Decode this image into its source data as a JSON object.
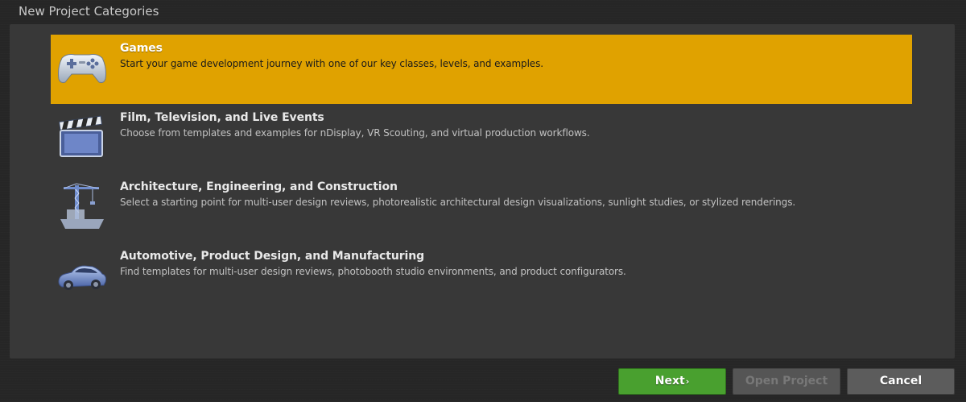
{
  "dialog": {
    "title": "New Project Categories"
  },
  "categories": [
    {
      "title": "Games",
      "description": "Start your game development journey with one of our key classes, levels, and examples.",
      "icon": "gamepad-icon",
      "selected": true
    },
    {
      "title": "Film, Television, and Live Events",
      "description": "Choose from templates and examples for nDisplay, VR Scouting, and virtual production workflows.",
      "icon": "clapperboard-icon",
      "selected": false
    },
    {
      "title": "Architecture, Engineering, and Construction",
      "description": "Select a starting point for multi-user design reviews, photorealistic architectural design visualizations, sunlight studies, or stylized renderings.",
      "icon": "crane-icon",
      "selected": false
    },
    {
      "title": "Automotive, Product Design, and Manufacturing",
      "description": "Find templates for multi-user design reviews, photobooth studio environments, and product configurators.",
      "icon": "car-icon",
      "selected": false
    }
  ],
  "buttons": {
    "next_label": "Next",
    "next_chevron": "›",
    "open_project_label": "Open Project",
    "open_project_enabled": false,
    "cancel_label": "Cancel"
  },
  "colors": {
    "selected_accent": "#e0a200",
    "next_button": "#49a02f",
    "panel": "#383838",
    "background": "#262626"
  }
}
